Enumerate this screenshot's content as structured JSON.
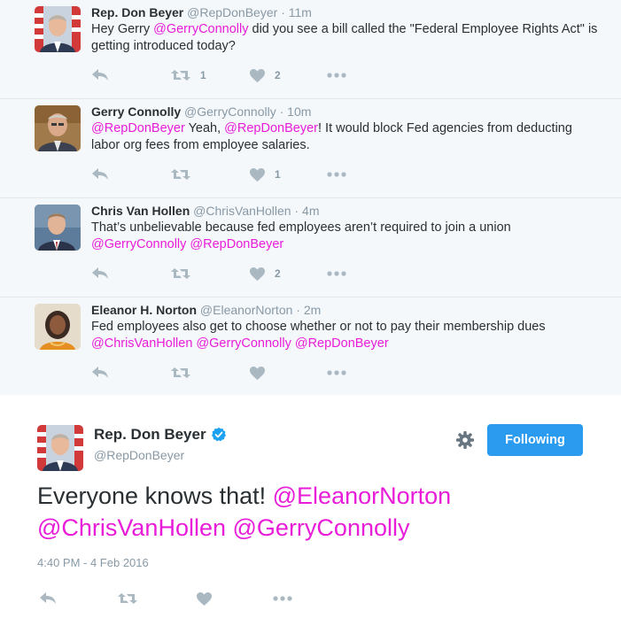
{
  "replies": [
    {
      "name": "Rep. Don Beyer",
      "handle": "@RepDonBeyer",
      "time": "· 11m",
      "text_parts": [
        {
          "t": "Hey Gerry ",
          "m": false
        },
        {
          "t": "@GerryConnolly",
          "m": true
        },
        {
          "t": " did you see a bill called the \"Federal Employee Rights Act\" is getting introduced today?",
          "m": false
        }
      ],
      "retweets": "1",
      "likes": "2"
    },
    {
      "name": "Gerry Connolly",
      "handle": "@GerryConnolly",
      "time": "· 10m",
      "text_parts": [
        {
          "t": "@RepDonBeyer",
          "m": true
        },
        {
          "t": " Yeah, ",
          "m": false
        },
        {
          "t": "@RepDonBeyer",
          "m": true
        },
        {
          "t": "! It would block Fed agencies from deducting labor org fees from employee salaries.",
          "m": false
        }
      ],
      "retweets": "",
      "likes": "1"
    },
    {
      "name": "Chris Van Hollen",
      "handle": "@ChrisVanHollen",
      "time": "· 4m",
      "text_parts": [
        {
          "t": "That’s unbelievable because fed employees aren’t required to join a union ",
          "m": false
        },
        {
          "t": "@GerryConnolly",
          "m": true
        },
        {
          "t": " ",
          "m": false
        },
        {
          "t": "@RepDonBeyer",
          "m": true
        }
      ],
      "retweets": "",
      "likes": "2"
    },
    {
      "name": "Eleanor H. Norton",
      "handle": "@EleanorNorton",
      "time": "· 2m",
      "text_parts": [
        {
          "t": "Fed employees also get to choose whether or not to pay their membership dues ",
          "m": false
        },
        {
          "t": "@ChrisVanHollen",
          "m": true
        },
        {
          "t": " ",
          "m": false
        },
        {
          "t": "@GerryConnolly",
          "m": true
        },
        {
          "t": " ",
          "m": false
        },
        {
          "t": "@RepDonBeyer",
          "m": true
        }
      ],
      "retweets": "",
      "likes": ""
    }
  ],
  "main_tweet": {
    "name": "Rep. Don Beyer",
    "handle": "@RepDonBeyer",
    "verified": true,
    "follow_label": "Following",
    "text_parts": [
      {
        "t": "Everyone knows that! ",
        "m": false
      },
      {
        "t": "@EleanorNorton",
        "m": true
      },
      {
        "t": " ",
        "m": false
      },
      {
        "t": "@ChrisVanHollen",
        "m": true
      },
      {
        "t": " ",
        "m": false
      },
      {
        "t": "@GerryConnolly",
        "m": true
      }
    ],
    "timestamp": "4:40 PM - 4 Feb 2016"
  },
  "icons": {
    "reply": "reply-icon",
    "retweet": "retweet-icon",
    "like": "heart-icon",
    "more": "more-dots-icon",
    "settings": "gear-icon",
    "verified": "verified-badge-icon"
  },
  "colors": {
    "mention": "#e81cd9",
    "follow_button": "#2b9bf0",
    "verified": "#1da1f2",
    "icon_gray": "#aab8c2",
    "thread_bg": "#f5f8fa"
  }
}
